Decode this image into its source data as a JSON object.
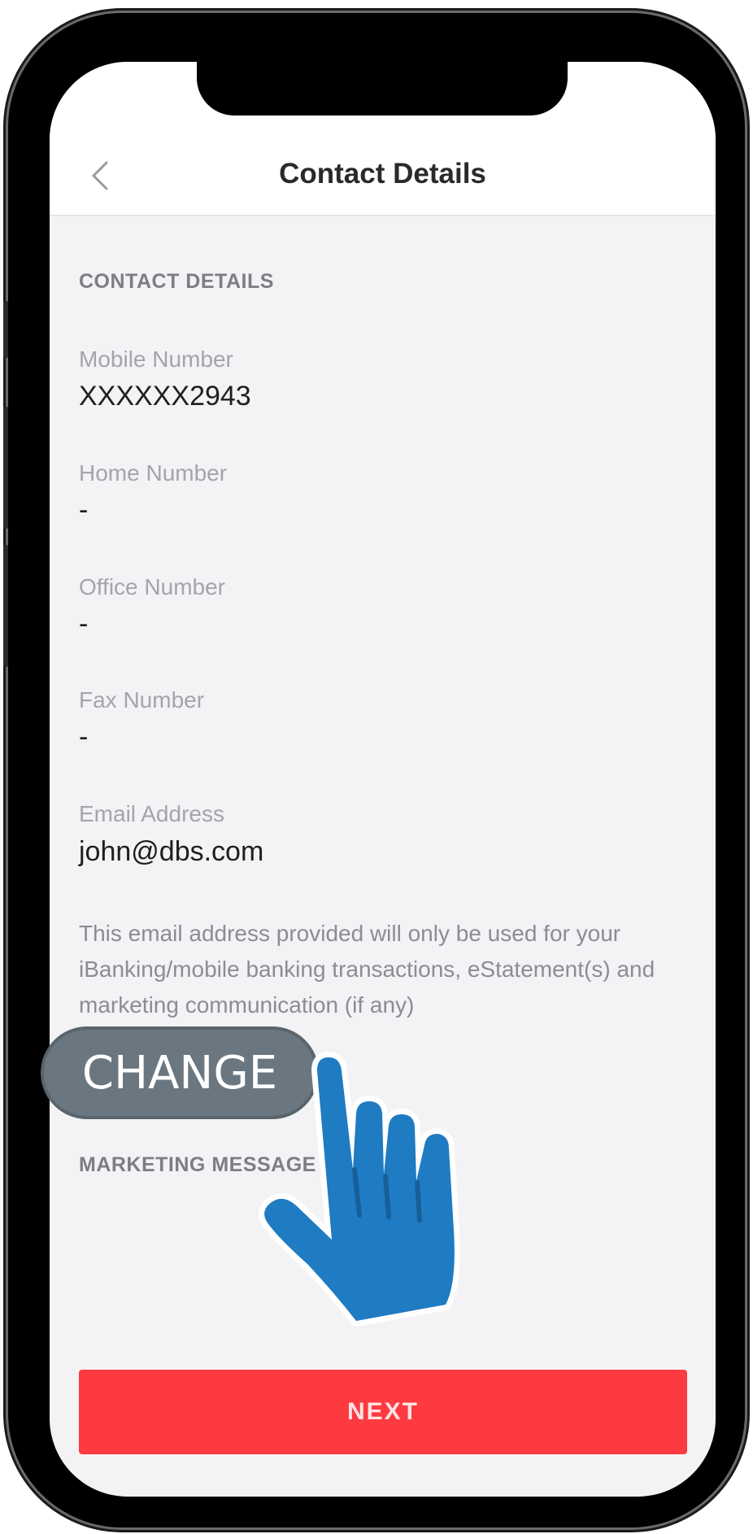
{
  "header": {
    "title": "Contact Details"
  },
  "section": {
    "contact_heading": "CONTACT DETAILS",
    "marketing_heading": "MARKETING MESSAGE"
  },
  "fields": {
    "mobile": {
      "label": "Mobile Number",
      "value": "XXXXXX2943"
    },
    "home": {
      "label": "Home Number",
      "value": "-"
    },
    "office": {
      "label": "Office Number",
      "value": "-"
    },
    "fax": {
      "label": "Fax Number",
      "value": "-"
    },
    "email": {
      "label": "Email Address",
      "value": "john@dbs.com"
    }
  },
  "note": "This email address provided will only be used for your iBanking/mobile banking transactions, eStatement(s) and marketing communication (if any)",
  "overlay": {
    "change_label": "CHANGE"
  },
  "actions": {
    "next_label": "NEXT"
  },
  "colors": {
    "accent": "#fd3a40",
    "pill": "#6b7780",
    "hand": "#1f7bc2"
  },
  "icons": [
    "back-chevron-icon",
    "pointing-hand-icon"
  ]
}
